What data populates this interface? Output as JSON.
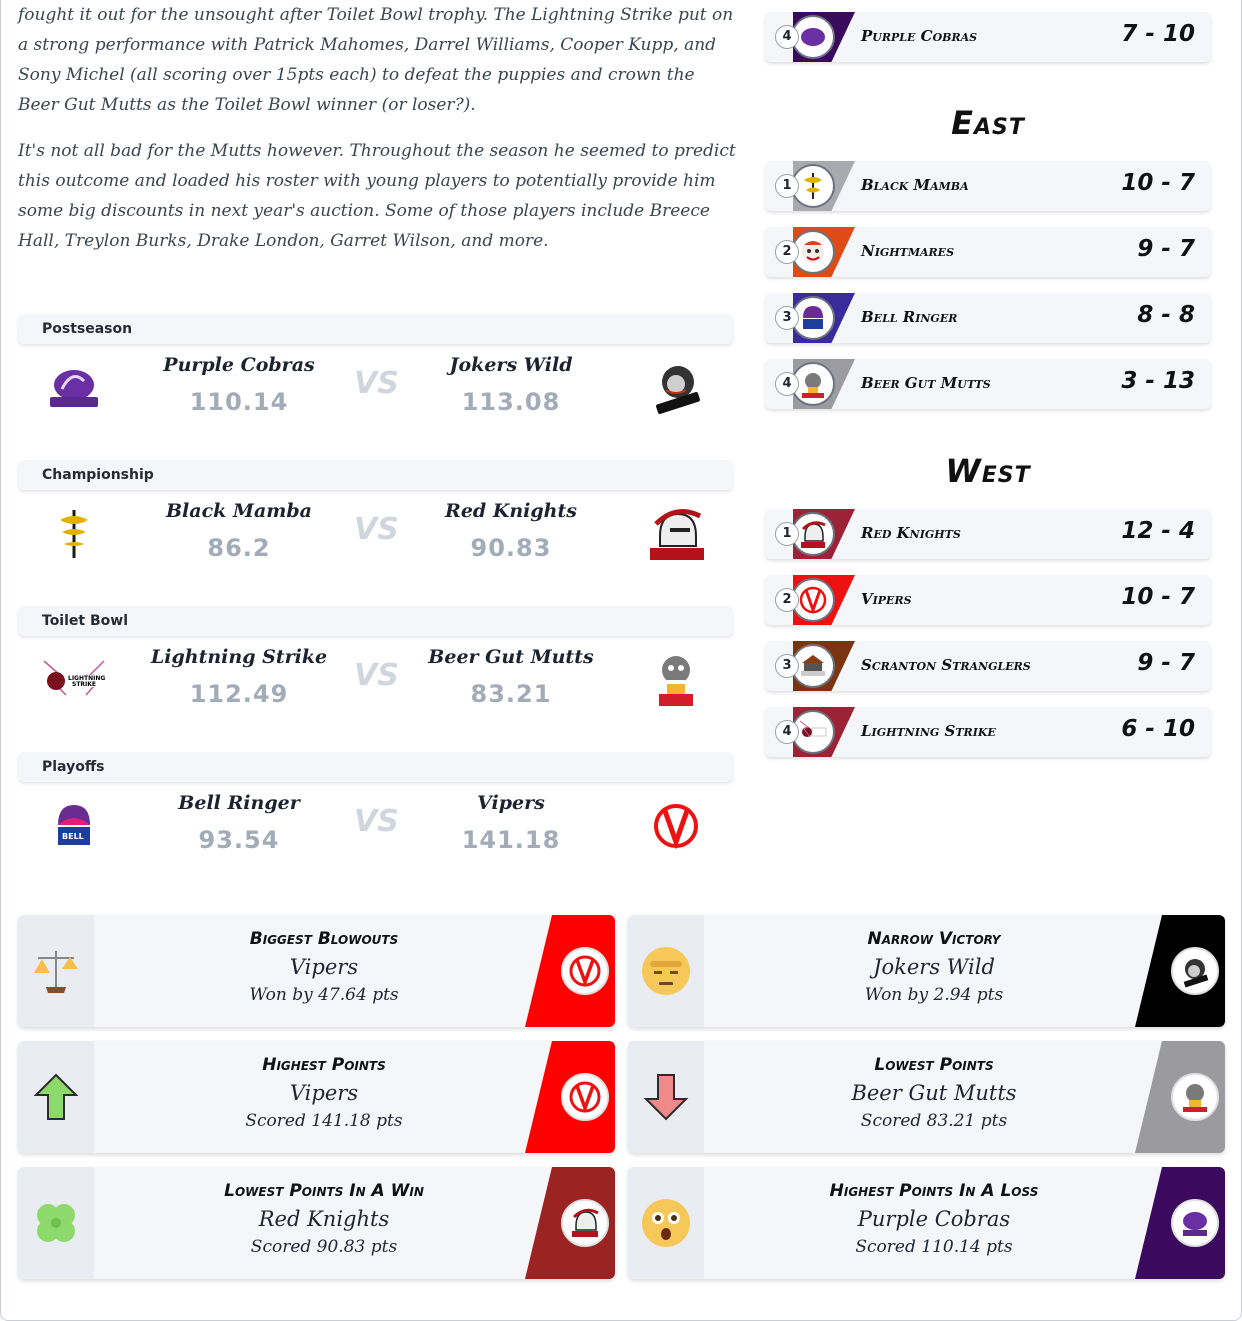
{
  "article": {
    "p1": "fought it out for the unsought after Toilet Bowl trophy. The Lightning Strike put on a strong performance with Patrick Mahomes, Darrel Williams, Cooper Kupp, and Sony Michel (all scoring over 15pts each) to defeat the puppies and crown the Beer Gut Mutts as the Toilet Bowl winner (or loser?).",
    "p2": "It's not all bad for the Mutts however. Throughout the season he seemed to predict this outcome and loaded his roster with young players to potentially provide him some big discounts in next year's auction. Some of those players include Breece Hall, Treylon Burks, Drake London, Garret Wilson, and more."
  },
  "vs_label": "VS",
  "matchups": [
    {
      "round": "Postseason",
      "home": {
        "name": "Purple Cobras",
        "score": "110.14",
        "logo": "purple-cobras-logo",
        "color": "#5b2a91"
      },
      "away": {
        "name": "Jokers Wild",
        "score": "113.08",
        "logo": "jokers-wild-logo",
        "color": "#111111"
      }
    },
    {
      "round": "Championship",
      "home": {
        "name": "Black Mamba",
        "score": "86.2",
        "logo": "black-mamba-logo",
        "color": "#e1b100"
      },
      "away": {
        "name": "Red Knights",
        "score": "90.83",
        "logo": "red-knights-logo",
        "color": "#b3121a"
      }
    },
    {
      "round": "Toilet Bowl",
      "home": {
        "name": "Lightning Strike",
        "score": "112.49",
        "logo": "lightning-strike-logo",
        "color": "#9b2335"
      },
      "away": {
        "name": "Beer Gut Mutts",
        "score": "83.21",
        "logo": "beer-gut-mutts-logo",
        "color": "#d01e2a"
      }
    },
    {
      "round": "Playoffs",
      "home": {
        "name": "Bell Ringer",
        "score": "93.54",
        "logo": "bell-ringer-logo",
        "color": "#6a2c91"
      },
      "away": {
        "name": "Vipers",
        "score": "141.18",
        "logo": "vipers-logo",
        "color": "#e11"
      }
    }
  ],
  "standings": {
    "north_tail": {
      "rank": "4",
      "name": "Purple Cobras",
      "record": "7 - 10",
      "color": "#3a0a5c"
    },
    "east": {
      "title": "East",
      "teams": [
        {
          "rank": "1",
          "name": "Black Mamba",
          "record": "10 - 7",
          "color": "#a9aab0"
        },
        {
          "rank": "2",
          "name": "Nightmares",
          "record": "9 - 7",
          "color": "#e04a14"
        },
        {
          "rank": "3",
          "name": "Bell Ringer",
          "record": "8 - 8",
          "color": "#3b2a9c"
        },
        {
          "rank": "4",
          "name": "Beer Gut Mutts",
          "record": "3 - 13",
          "color": "#9b9ba1"
        }
      ]
    },
    "west": {
      "title": "West",
      "teams": [
        {
          "rank": "1",
          "name": "Red Knights",
          "record": "12 - 4",
          "color": "#9b2335"
        },
        {
          "rank": "2",
          "name": "Vipers",
          "record": "10 - 7",
          "color": "#ee1111"
        },
        {
          "rank": "3",
          "name": "Scranton Stranglers",
          "record": "9 - 7",
          "color": "#7a3510"
        },
        {
          "rank": "4",
          "name": "Lightning Strike",
          "record": "6 - 10",
          "color": "#9b2335"
        }
      ]
    }
  },
  "awards": [
    {
      "title": "Biggest Blowouts",
      "team": "Vipers",
      "detail": "Won by 47.64 pts",
      "icon": "scales-icon",
      "color": "#ff0000"
    },
    {
      "title": "Narrow Victory",
      "team": "Jokers Wild",
      "detail": "Won by 2.94 pts",
      "icon": "sweat-face-icon",
      "color": "#000000"
    },
    {
      "title": "Highest Points",
      "team": "Vipers",
      "detail": "Scored 141.18 pts",
      "icon": "arrow-up-icon",
      "color": "#ff0000"
    },
    {
      "title": "Lowest Points",
      "team": "Beer Gut Mutts",
      "detail": "Scored 83.21 pts",
      "icon": "arrow-down-icon",
      "color": "#9a9a9f"
    },
    {
      "title": "Lowest Points In A Win",
      "team": "Red Knights",
      "detail": "Scored 90.83 pts",
      "icon": "clover-icon",
      "color": "#9b2322"
    },
    {
      "title": "Highest Points In A Loss",
      "team": "Purple Cobras",
      "detail": "Scored 110.14 pts",
      "icon": "shocked-face-icon",
      "color": "#3b0a5e"
    }
  ]
}
